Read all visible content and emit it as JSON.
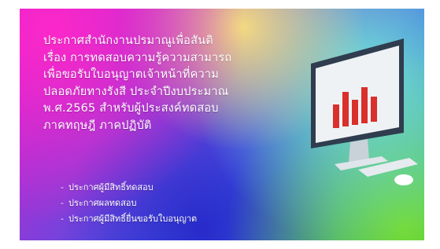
{
  "banner": {
    "title_lines": [
      "ประกาศสำนักงานปรมาณูเพื่อสันติ",
      "เรื่อง  การทดสอบความรู้ความสามารถ",
      "เพื่อขอรับใบอนุญาตเจ้าหน้าที่ความ",
      "ปลอดภัยทางรังสี  ประจำปีงบประมาณ",
      "พ.ศ.2565  สำหรับผู้ประสงค์ทดสอบ",
      "ภาคทฤษฎี  ภาคปฏิบัติ"
    ],
    "links": [
      "ประกาศผู้มีสิทธิ์ทดสอบ",
      "ประกาศผลทดสอบ",
      "ประกาศผู้มีสิทธิ์ยื่นขอรับใบอนุญาต"
    ],
    "illustration_icons": [
      "computer-monitor-icon",
      "bar-chart-icon",
      "keyboard-icon",
      "mouse-icon"
    ]
  }
}
